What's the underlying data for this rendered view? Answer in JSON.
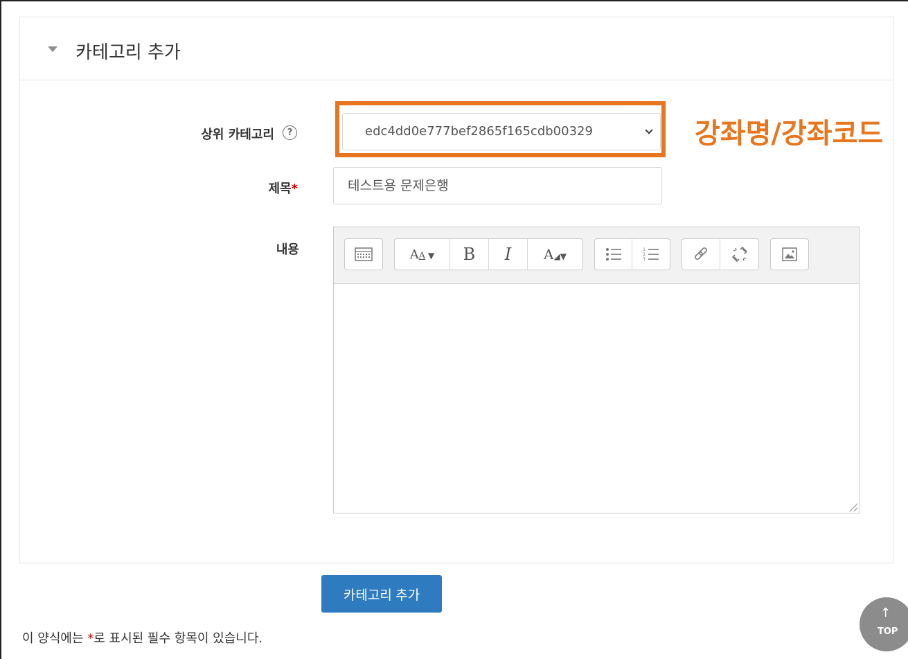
{
  "form": {
    "section_title": "카테고리 추가",
    "parent_category_label": "상위 카테고리",
    "parent_category_help": "?",
    "parent_category_value": "edc4dd0e777bef2865f165cdb00329",
    "title_label": "제목",
    "required_marker": "*",
    "title_value": "테스트용 문제은행",
    "content_label": "내용",
    "submit_label": "카테고리 추가",
    "footnote_prefix": "이 양식에는 ",
    "footnote_marker": "*",
    "footnote_suffix": "로 표시된 필수 항목이 있습니다."
  },
  "annotation": {
    "text": "강좌명/강좌코드",
    "color": "#e8761e"
  },
  "editor_toolbar": {
    "font_size_glyph": "A",
    "bold_glyph": "B",
    "italic_glyph": "I",
    "text_color_glyph": "A"
  },
  "top_button": {
    "arrow": "↑",
    "label": "TOP"
  },
  "colors": {
    "primary_button": "#2f7bbf",
    "required": "#cc0000"
  },
  "icons": [
    "caret-down-icon",
    "help-icon",
    "chevron-down-icon",
    "toolbar-toggle-icon",
    "font-size-icon",
    "bold-icon",
    "italic-icon",
    "text-color-icon",
    "unordered-list-icon",
    "ordered-list-icon",
    "link-icon",
    "unlink-icon",
    "image-icon",
    "resize-handle-icon"
  ]
}
